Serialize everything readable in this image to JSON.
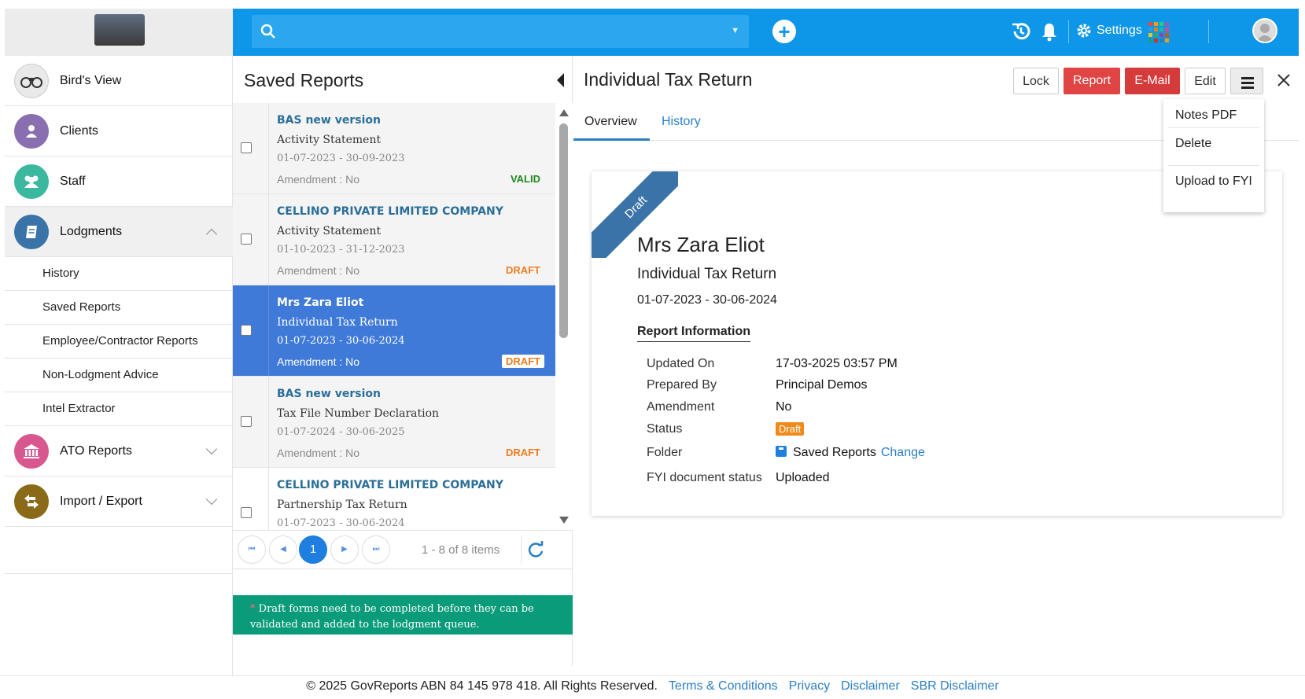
{
  "topbar": {
    "search_placeholder": "",
    "settings_label": "Settings",
    "accent": "#0e96e8"
  },
  "sidebar": {
    "items": [
      {
        "label": "Bird's View",
        "icon": "binoculars-icon",
        "color": "#e8e8e8"
      },
      {
        "label": "Clients",
        "icon": "user-icon",
        "color": "#8a6fb0"
      },
      {
        "label": "Staff",
        "icon": "users-icon",
        "color": "#3db8a0"
      },
      {
        "label": "Lodgments",
        "icon": "book-icon",
        "color": "#3a73a8"
      },
      {
        "label": "ATO Reports",
        "icon": "bank-icon",
        "color": "#d8578f"
      },
      {
        "label": "Import / Export",
        "icon": "swap-icon",
        "color": "#8a6a18"
      }
    ],
    "sub_items": [
      "History",
      "Saved Reports",
      "Employee/Contractor Reports",
      "Non-Lodgment Advice",
      "Intel Extractor"
    ]
  },
  "saved_reports": {
    "title": "Saved Reports",
    "rows": [
      {
        "name": "BAS new version",
        "type": "Activity Statement",
        "period": "01-07-2023 - 30-09-2023",
        "amendment": "Amendment : No",
        "status": "VALID"
      },
      {
        "name": "CELLINO PRIVATE LIMITED COMPANY",
        "type": "Activity Statement",
        "period": "01-10-2023 - 31-12-2023",
        "amendment": "Amendment : No",
        "status": "DRAFT"
      },
      {
        "name": "Mrs Zara Eliot",
        "type": "Individual Tax Return",
        "period": "01-07-2023 - 30-06-2024",
        "amendment": "Amendment : No",
        "status": "DRAFT"
      },
      {
        "name": "BAS new version",
        "type": "Tax File Number Declaration",
        "period": "01-07-2024 - 30-06-2025",
        "amendment": "Amendment : No",
        "status": "DRAFT"
      },
      {
        "name": "CELLINO PRIVATE LIMITED COMPANY",
        "type": "Partnership Tax Return",
        "period": "01-07-2023 - 30-06-2024",
        "amendment": "",
        "status": ""
      }
    ],
    "pager": {
      "current": "1",
      "info": "1 - 8 of 8 items"
    },
    "note": "Draft forms need to be completed before they can be validated and added to the lodgment queue."
  },
  "detail": {
    "title": "Individual Tax Return",
    "buttons": {
      "lock": "Lock",
      "report": "Report",
      "email": "E-Mail",
      "edit": "Edit"
    },
    "tabs": {
      "overview": "Overview",
      "history": "History"
    },
    "ribbon": "Draft",
    "name": "Mrs Zara Eliot",
    "type": "Individual Tax Return",
    "period": "01-07-2023 - 30-06-2024",
    "section_title": "Report Information",
    "info": {
      "updated_on_label": "Updated On",
      "updated_on": "17-03-2025 03:57 PM",
      "prepared_by_label": "Prepared By",
      "prepared_by": "Principal Demos",
      "amendment_label": "Amendment",
      "amendment": "No",
      "status_label": "Status",
      "status": "Draft",
      "folder_label": "Folder",
      "folder": "Saved Reports",
      "folder_change": "Change",
      "fyi_label": "FYI document status",
      "fyi": "Uploaded"
    },
    "dropdown": [
      "Notes PDF",
      "Delete",
      "Upload to FYI"
    ]
  },
  "footer": {
    "copyright": "© 2025 GovReports ABN 84 145 978 418. All Rights Reserved.",
    "links": [
      "Terms & Conditions",
      "Privacy",
      "Disclaimer",
      "SBR Disclaimer"
    ]
  }
}
